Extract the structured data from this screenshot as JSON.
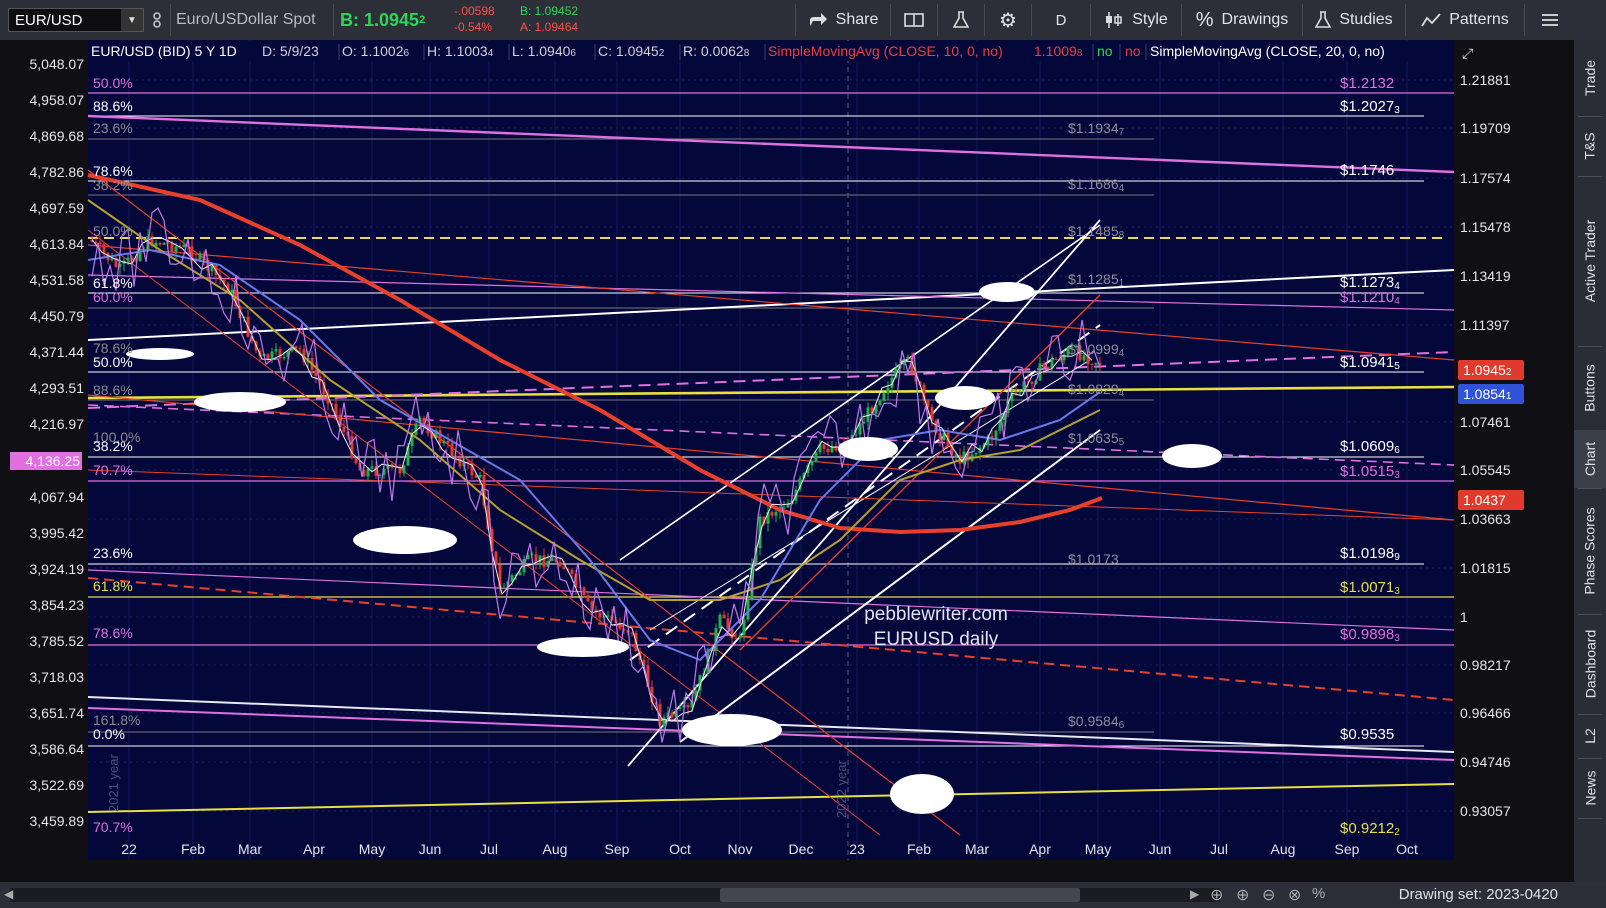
{
  "toolbar": {
    "symbol": "EUR/USD",
    "description": "Euro/USDollar Spot",
    "bid_label": "B: 1.0945",
    "bid_sub": "2",
    "change_abs": "-.00598",
    "change_pct": "-0.54%",
    "bid_small": "B: 1.09452",
    "ask_small": "A: 1.09464",
    "share": "Share",
    "period": "D",
    "style": "Style",
    "drawings": "Drawings",
    "studies": "Studies",
    "patterns": "Patterns"
  },
  "chart": {
    "header": {
      "instrument": "EUR/USD (BID) 5 Y 1D",
      "date": "D: 5/9/23",
      "open": "O: 1.1002",
      "open_sub": "6",
      "high": "H: 1.1003",
      "high_sub": "4",
      "low": "L: 1.0940",
      "low_sub": "6",
      "close": "C: 1.0945",
      "close_sub": "2",
      "range": "R: 0.0062",
      "range_sub": "8",
      "sma10": "SimpleMovingAvg (CLOSE, 10, 0, no)",
      "sma10_val": "1.1009",
      "sma10_sub": "8",
      "flag_no1": "no",
      "flag_no2": "no",
      "sma20": "SimpleMovingAvg (CLOSE, 20, 0, no)"
    },
    "left_axis": [
      "5,048.07",
      "4,958.07",
      "4,869.68",
      "4,782.86",
      "4,697.59",
      "4,613.84",
      "4,531.58",
      "4,450.79",
      "4,371.44",
      "4,293.51",
      "4,216.97",
      "4,136.25",
      "4,067.94",
      "3,995.42",
      "3,924.19",
      "3,854.23",
      "3,785.52",
      "3,718.03",
      "3,651.74",
      "3,586.64",
      "3,522.69",
      "3,459.89"
    ],
    "left_axis_highlight": "4,136.25",
    "right_axis": [
      "1.21881",
      "1.19709",
      "1.17574",
      "1.15478",
      "1.13419",
      "1.11397",
      "1.07461",
      "1.05545",
      "1.03663",
      "1.01815",
      "1",
      "0.98217",
      "0.96466",
      "0.94746",
      "0.93057"
    ],
    "price_tags": [
      {
        "text": "1.0945",
        "sub": "2",
        "color": "#e03a2c"
      },
      {
        "text": "1.0854",
        "sub": "1",
        "color": "#2f52d8"
      },
      {
        "text": "1.0437",
        "sub": "",
        "color": "#e03a2c"
      }
    ],
    "x_axis": [
      "22",
      "Feb",
      "Mar",
      "Apr",
      "May",
      "Jun",
      "Jul",
      "Aug",
      "Sep",
      "Oct",
      "Nov",
      "Dec",
      "23",
      "Feb",
      "Mar",
      "Apr",
      "May",
      "Jun",
      "Jul",
      "Aug",
      "Sep",
      "Oct"
    ],
    "year_labels": [
      "2021 year",
      "2022 year"
    ],
    "fib_left": [
      {
        "text": "50.0%",
        "color": "#e070e0"
      },
      {
        "text": "88.6%",
        "color": "#ffffff"
      },
      {
        "text": "23.6%",
        "color": "#8a8a8a"
      },
      {
        "text": "78.6%",
        "color": "#ffffff"
      },
      {
        "text": "38.2%",
        "color": "#8a8a8a"
      },
      {
        "text": "50.0%",
        "color": "#8a8a8a"
      },
      {
        "text": "61.8%",
        "color": "#ffffff"
      },
      {
        "text": "60.0%",
        "color": "#e070e0"
      },
      {
        "text": "78.6%",
        "color": "#8a8a8a"
      },
      {
        "text": "50.0%",
        "color": "#ffffff"
      },
      {
        "text": "88.6%",
        "color": "#8a8a8a"
      },
      {
        "text": "100.0%",
        "color": "#8a8a8a"
      },
      {
        "text": "38.2%",
        "color": "#ffffff"
      },
      {
        "text": "70.7%",
        "color": "#e070e0"
      },
      {
        "text": "23.6%",
        "color": "#ffffff"
      },
      {
        "text": "61.8%",
        "color": "#e8e040"
      },
      {
        "text": "78.6%",
        "color": "#e070e0"
      },
      {
        "text": "161.8%",
        "color": "#8a8a8a"
      },
      {
        "text": "0.0%",
        "color": "#ffffff"
      },
      {
        "text": "70.7%",
        "color": "#e070e0"
      }
    ],
    "levels_right": [
      {
        "text": "$1.2132",
        "sub": "",
        "color": "#e070e0"
      },
      {
        "text": "$1.2027",
        "sub": "3",
        "color": "#ffffff"
      },
      {
        "text": "$1.1746",
        "sub": "",
        "color": "#ffffff"
      },
      {
        "text": "$1.1273",
        "sub": "4",
        "color": "#ffffff"
      },
      {
        "text": "$1.1210",
        "sub": "4",
        "color": "#e070e0"
      },
      {
        "text": "$1.0941",
        "sub": "5",
        "color": "#ffffff"
      },
      {
        "text": "$1.0609",
        "sub": "6",
        "color": "#ffffff"
      },
      {
        "text": "$1.0515",
        "sub": "3",
        "color": "#e070e0"
      },
      {
        "text": "$1.0198",
        "sub": "9",
        "color": "#ffffff"
      },
      {
        "text": "$1.0071",
        "sub": "3",
        "color": "#e8e040"
      },
      {
        "text": "$0.9898",
        "sub": "3",
        "color": "#e070e0"
      },
      {
        "text": "$0.9535",
        "sub": "",
        "color": "#ffffff"
      },
      {
        "text": "$0.9212",
        "sub": "2",
        "color": "#e8e040"
      }
    ],
    "levels_mid": [
      {
        "text": "$1.1934",
        "sub": "7"
      },
      {
        "text": "$1.1686",
        "sub": "4"
      },
      {
        "text": "$1.1485",
        "sub": "8"
      },
      {
        "text": "$1.1285",
        "sub": "1"
      },
      {
        "text": "$1.0999",
        "sub": "4"
      },
      {
        "text": "$1.0829",
        "sub": "4"
      },
      {
        "text": "$1.0635",
        "sub": "5"
      },
      {
        "text": "$1.0173",
        "sub": ""
      },
      {
        "text": "$0.9584",
        "sub": "6"
      }
    ],
    "watermark": [
      "pebblewriter.com",
      "EURUSD daily"
    ]
  },
  "side_tabs": [
    "Trade",
    "T&S",
    "Active Trader",
    "Buttons",
    "Chart",
    "Phase Scores",
    "Dashboard",
    "L2",
    "News"
  ],
  "active_tab": "Chart",
  "bottom": {
    "drawing_set": "Drawing set: 2023-0420"
  },
  "colors": {
    "chart_bg": "#04073a",
    "fib_white": "#ffffff",
    "fib_magenta": "#e070e0",
    "fib_yellow": "#e8e040",
    "ma_red": "#e8402a",
    "ma_blue": "#6a78e8",
    "ma_olive": "#b8a030",
    "candle_up": "#22b04a",
    "candle_down": "#e03a2c"
  }
}
